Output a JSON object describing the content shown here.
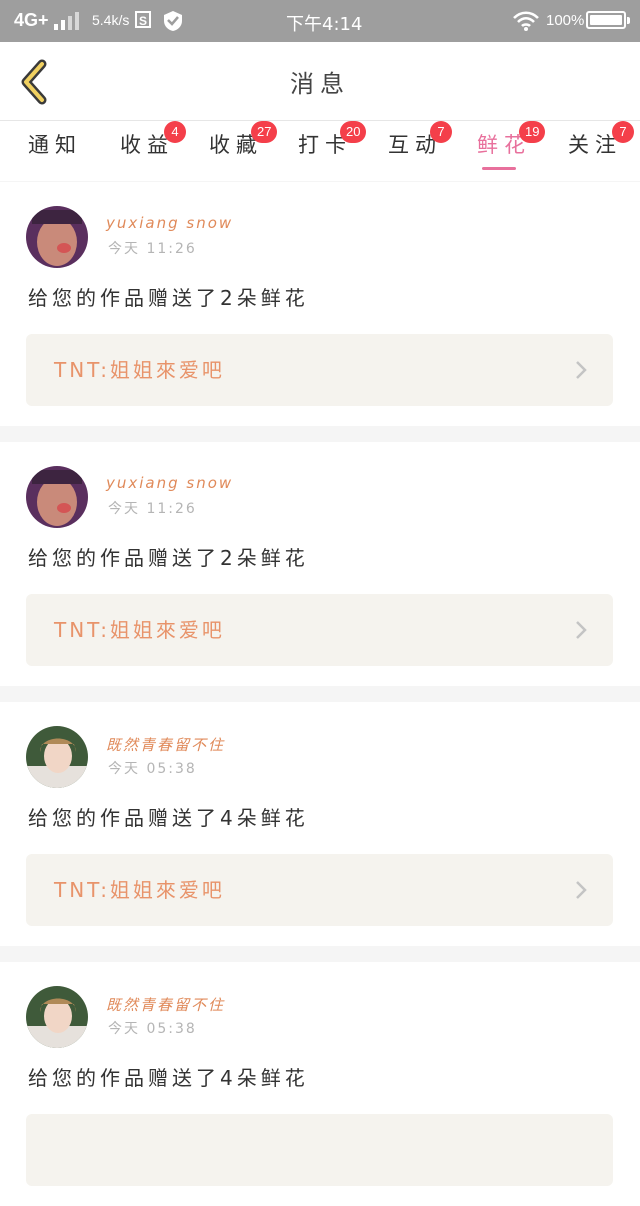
{
  "status_bar": {
    "network": "4G+",
    "speed": "5.4k/s",
    "s_icon_text": "S",
    "time": "下午4:14",
    "battery": "100%"
  },
  "header": {
    "title": "消息"
  },
  "tabs": [
    {
      "label": "通知",
      "badge": ""
    },
    {
      "label": "收益",
      "badge": "4"
    },
    {
      "label": "收藏",
      "badge": "27"
    },
    {
      "label": "打卡",
      "badge": "20"
    },
    {
      "label": "互动",
      "badge": "7"
    },
    {
      "label": "鲜花",
      "badge": "19",
      "active": true
    },
    {
      "label": "关注",
      "badge": "7"
    }
  ],
  "colors": {
    "accent": "#e8709c",
    "badge": "#f43f4a",
    "username": "#e08a5a",
    "work_text": "#e8936a"
  },
  "messages": [
    {
      "username": "yuxiang snow",
      "time": "今天 11:26",
      "text": "给您的作品赠送了2朵鲜花",
      "work": "TNT:姐姐來爱吧",
      "avatar": "man-photo"
    },
    {
      "username": "yuxiang snow",
      "time": "今天 11:26",
      "text": "给您的作品赠送了2朵鲜花",
      "work": "TNT:姐姐來爱吧",
      "avatar": "man-photo"
    },
    {
      "username": "既然青春留不住",
      "time": "今天 05:38",
      "text": "给您的作品赠送了4朵鲜花",
      "work": "TNT:姐姐來爱吧",
      "avatar": "boy-photo"
    },
    {
      "username": "既然青春留不住",
      "time": "今天 05:38",
      "text": "给您的作品赠送了4朵鲜花",
      "work": "",
      "avatar": "boy-photo"
    }
  ]
}
